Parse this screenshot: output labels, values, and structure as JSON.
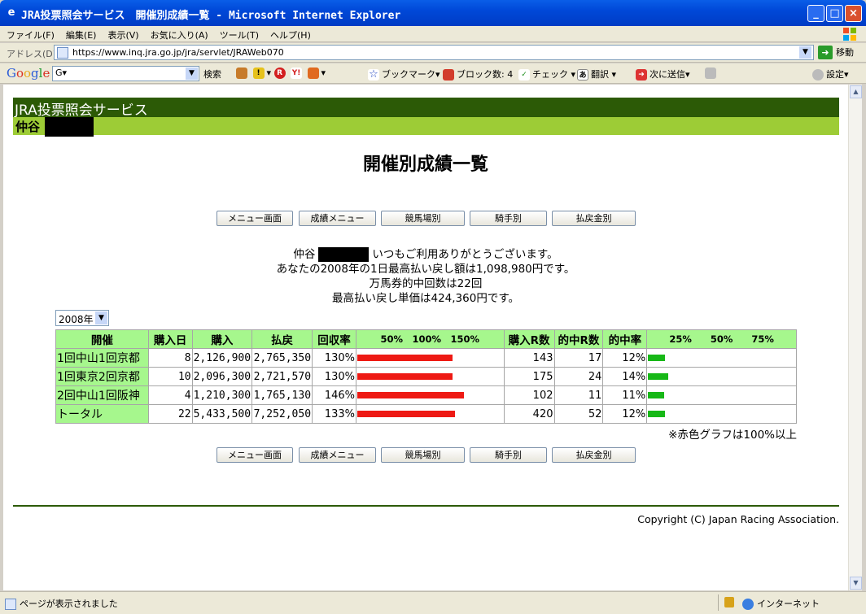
{
  "window": {
    "title": "JRA投票照会サービス　開催別成績一覧 - Microsoft Internet Explorer",
    "icon": "ie-icon"
  },
  "menu": [
    "ファイル(F)",
    "編集(E)",
    "表示(V)",
    "お気に入り(A)",
    "ツール(T)",
    "ヘルプ(H)"
  ],
  "address": {
    "label": "アドレス(D)",
    "url": "https://www.inq.jra.go.jp/jra/servlet/JRAWeb070",
    "go_label": "移動"
  },
  "google_toolbar": {
    "logo": "Google",
    "search_value": "G▾",
    "search_label": "検索",
    "bookmark": "ブックマーク▾",
    "block_count": "ブロック数: 4",
    "check": "チェック",
    "translate": "翻訳",
    "send_to": "次に送信▾",
    "settings": "設定▾"
  },
  "page": {
    "service_title": "JRA投票照会サービス",
    "user_name": "仲谷",
    "heading": "開催別成績一覧",
    "nav_buttons": [
      "メニュー画面",
      "成績メニュー",
      "競馬場別",
      "騎手別",
      "払戻金別"
    ],
    "greeting": {
      "name": "仲谷",
      "thanks": "いつもご利用ありがとうございます。",
      "line2": "あなたの2008年の1日最高払い戻し額は1,098,980円です。",
      "line3": "万馬券的中回数は22回",
      "line4": "最高払い戻し単価は424,360円です。"
    },
    "year_select": "2008年",
    "table": {
      "headers": {
        "meeting": "開催",
        "days": "購入日",
        "purchase": "購入",
        "payout": "払戻",
        "recovery": "回収率",
        "recovery_scale": "50%　100%　150%",
        "races": "購入R数",
        "hit_races": "的中R数",
        "hit_rate": "的中率",
        "hit_scale": "25%　　50%　　75%"
      },
      "rows": [
        {
          "meeting": "1回中山1回京都",
          "days": "8",
          "purchase": "2,126,900",
          "payout": "2,765,350",
          "recovery": "130%",
          "recovery_value": 130,
          "races": "143",
          "hits": "17",
          "hit_rate": "12%",
          "hit_value": 12
        },
        {
          "meeting": "1回東京2回京都",
          "days": "10",
          "purchase": "2,096,300",
          "payout": "2,721,570",
          "recovery": "130%",
          "recovery_value": 130,
          "races": "175",
          "hits": "24",
          "hit_rate": "14%",
          "hit_value": 14
        },
        {
          "meeting": "2回中山1回阪神",
          "days": "4",
          "purchase": "1,210,300",
          "payout": "1,765,130",
          "recovery": "146%",
          "recovery_value": 146,
          "races": "102",
          "hits": "11",
          "hit_rate": "11%",
          "hit_value": 11
        },
        {
          "meeting": "トータル",
          "days": "22",
          "purchase": "5,433,500",
          "payout": "7,252,050",
          "recovery": "133%",
          "recovery_value": 133,
          "races": "420",
          "hits": "52",
          "hit_rate": "12%",
          "hit_value": 12
        }
      ]
    },
    "note": "※赤色グラフは100%以上",
    "copyright": "Copyright (C) Japan Racing Association."
  },
  "status": {
    "text": "ページが表示されました",
    "zone": "インターネット"
  },
  "colors": {
    "banner_dark": "#2c5a06",
    "banner_light": "#9dcc36",
    "header_green": "#a6f78d",
    "bar_red": "#ee1a14",
    "bar_green": "#17b817"
  }
}
